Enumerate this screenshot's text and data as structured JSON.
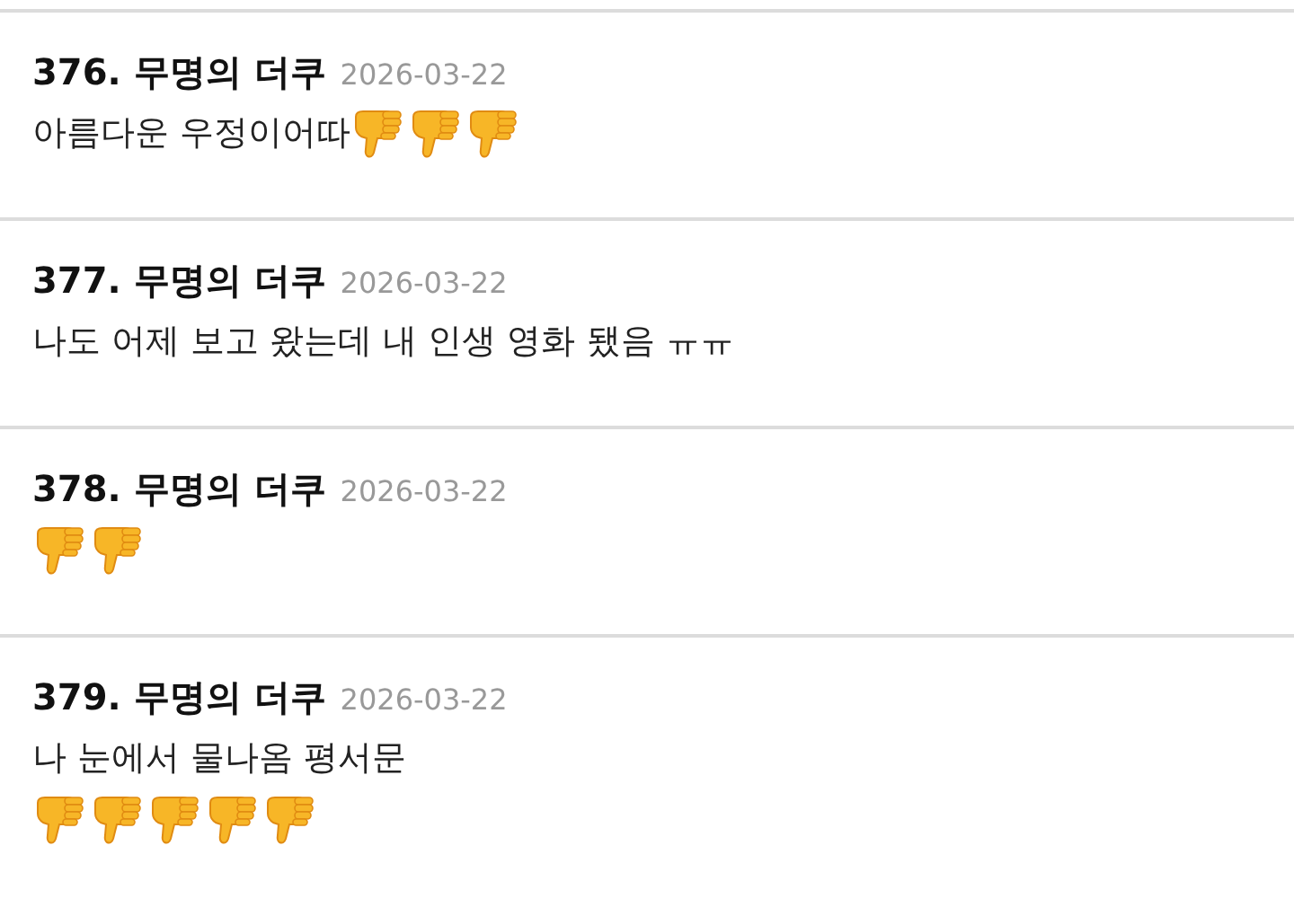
{
  "comments": [
    {
      "title": "376. 무명의 더쿠",
      "date": "2026-03-22",
      "lines": [
        {
          "text": "아름다운 우정이어따",
          "emoji": [
            {
              "kind": "thumbs-down"
            },
            {
              "kind": "thumbs-down"
            },
            {
              "kind": "thumbs-down"
            }
          ]
        }
      ]
    },
    {
      "title": "377. 무명의 더쿠",
      "date": "2026-03-22",
      "lines": [
        {
          "text": "나도 어제 보고 왔는데 내 인생 영화 됐음 ㅠㅠ"
        }
      ]
    },
    {
      "title": "378. 무명의 더쿠",
      "date": "2026-03-22",
      "lines": [
        {
          "emoji": [
            {
              "kind": "thumbs-down"
            },
            {
              "kind": "thumbs-down"
            }
          ]
        }
      ]
    },
    {
      "title": "379. 무명의 더쿠",
      "date": "2026-03-22",
      "lines": [
        {
          "text": "나 눈에서 물나옴 평서문"
        },
        {
          "emoji": [
            {
              "kind": "thumbs-down"
            },
            {
              "kind": "thumbs-down"
            },
            {
              "kind": "thumbs-down"
            },
            {
              "kind": "thumbs-down"
            },
            {
              "kind": "thumbs-down"
            }
          ]
        }
      ]
    }
  ]
}
